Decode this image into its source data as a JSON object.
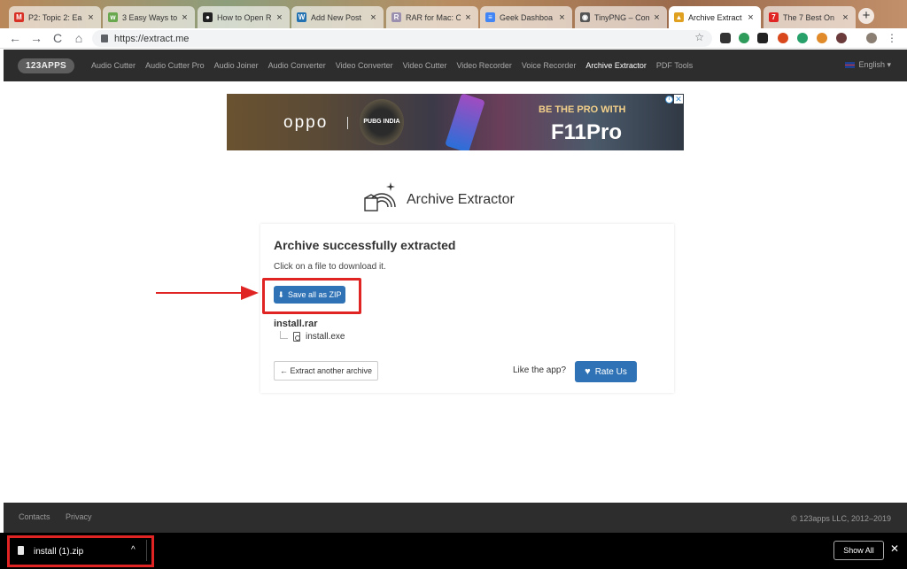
{
  "browser": {
    "tabs": [
      {
        "title": "P2: Topic 2: Ea",
        "favicon": "gmail-icon",
        "favicon_color": "#d93025",
        "favicon_glyph": "M"
      },
      {
        "title": "3 Easy Ways to",
        "favicon": "wikihow-icon",
        "favicon_color": "#6aa84f",
        "favicon_glyph": "w"
      },
      {
        "title": "How to Open R",
        "favicon": "site-icon",
        "favicon_color": "#222222",
        "favicon_glyph": "●"
      },
      {
        "title": "Add New Post",
        "favicon": "wordpress-icon",
        "favicon_color": "#2271b1",
        "favicon_glyph": "W"
      },
      {
        "title": "RAR for Mac: O",
        "favicon": "rar-icon",
        "favicon_color": "#9b8fb0",
        "favicon_glyph": "R"
      },
      {
        "title": "Geek Dashboa",
        "favicon": "docs-icon",
        "favicon_color": "#4285f4",
        "favicon_glyph": "≡"
      },
      {
        "title": "TinyPNG – Com",
        "favicon": "panda-icon",
        "favicon_color": "#555555",
        "favicon_glyph": "◉"
      },
      {
        "title": "Archive Extract",
        "favicon": "archive-extractor-icon",
        "favicon_color": "#e0a020",
        "favicon_glyph": "▲",
        "active": true
      },
      {
        "title": "The 7 Best On",
        "favicon": "site-icon",
        "favicon_color": "#e02424",
        "favicon_glyph": "7"
      }
    ],
    "new_tab_label": "+",
    "url": "https://extract.me",
    "nav_icons": {
      "back": "←",
      "forward": "→",
      "reload": "C",
      "home": "⌂",
      "star": "☆"
    }
  },
  "site_nav": {
    "logo": "123APPS",
    "links": [
      "Audio Cutter",
      "Audio Cutter Pro",
      "Audio Joiner",
      "Audio Converter",
      "Video Converter",
      "Video Cutter",
      "Video Recorder",
      "Voice Recorder",
      "Archive Extractor",
      "PDF Tools"
    ],
    "active_link": "Archive Extractor",
    "language": "English ▾"
  },
  "ad": {
    "brand": "oppo",
    "badge": "PUBG INDIA",
    "tagline": "BE THE PRO WITH",
    "product": "F11Pro",
    "info_glyph": "i",
    "close_glyph": "✕"
  },
  "app": {
    "title": "Archive Extractor"
  },
  "result": {
    "heading": "Archive successfully extracted",
    "subtext": "Click on a file to download it.",
    "save_zip_label": "Save all as ZIP",
    "archive_name": "install.rar",
    "files": [
      "install.exe"
    ],
    "extract_another_label": "← Extract another archive",
    "like_text": "Like the app?",
    "rate_label": "Rate Us"
  },
  "footer": {
    "contacts": "Contacts",
    "privacy": "Privacy",
    "copyright": "© 123apps LLC, 2012–2019"
  },
  "downloads": {
    "file_name": "install (1).zip",
    "caret": "^",
    "show_all": "Show All",
    "close": "✕"
  },
  "colors": {
    "accent_blue": "#2f73b6",
    "annotation_red": "#e02424",
    "nav_dark": "#2d2d2d"
  }
}
